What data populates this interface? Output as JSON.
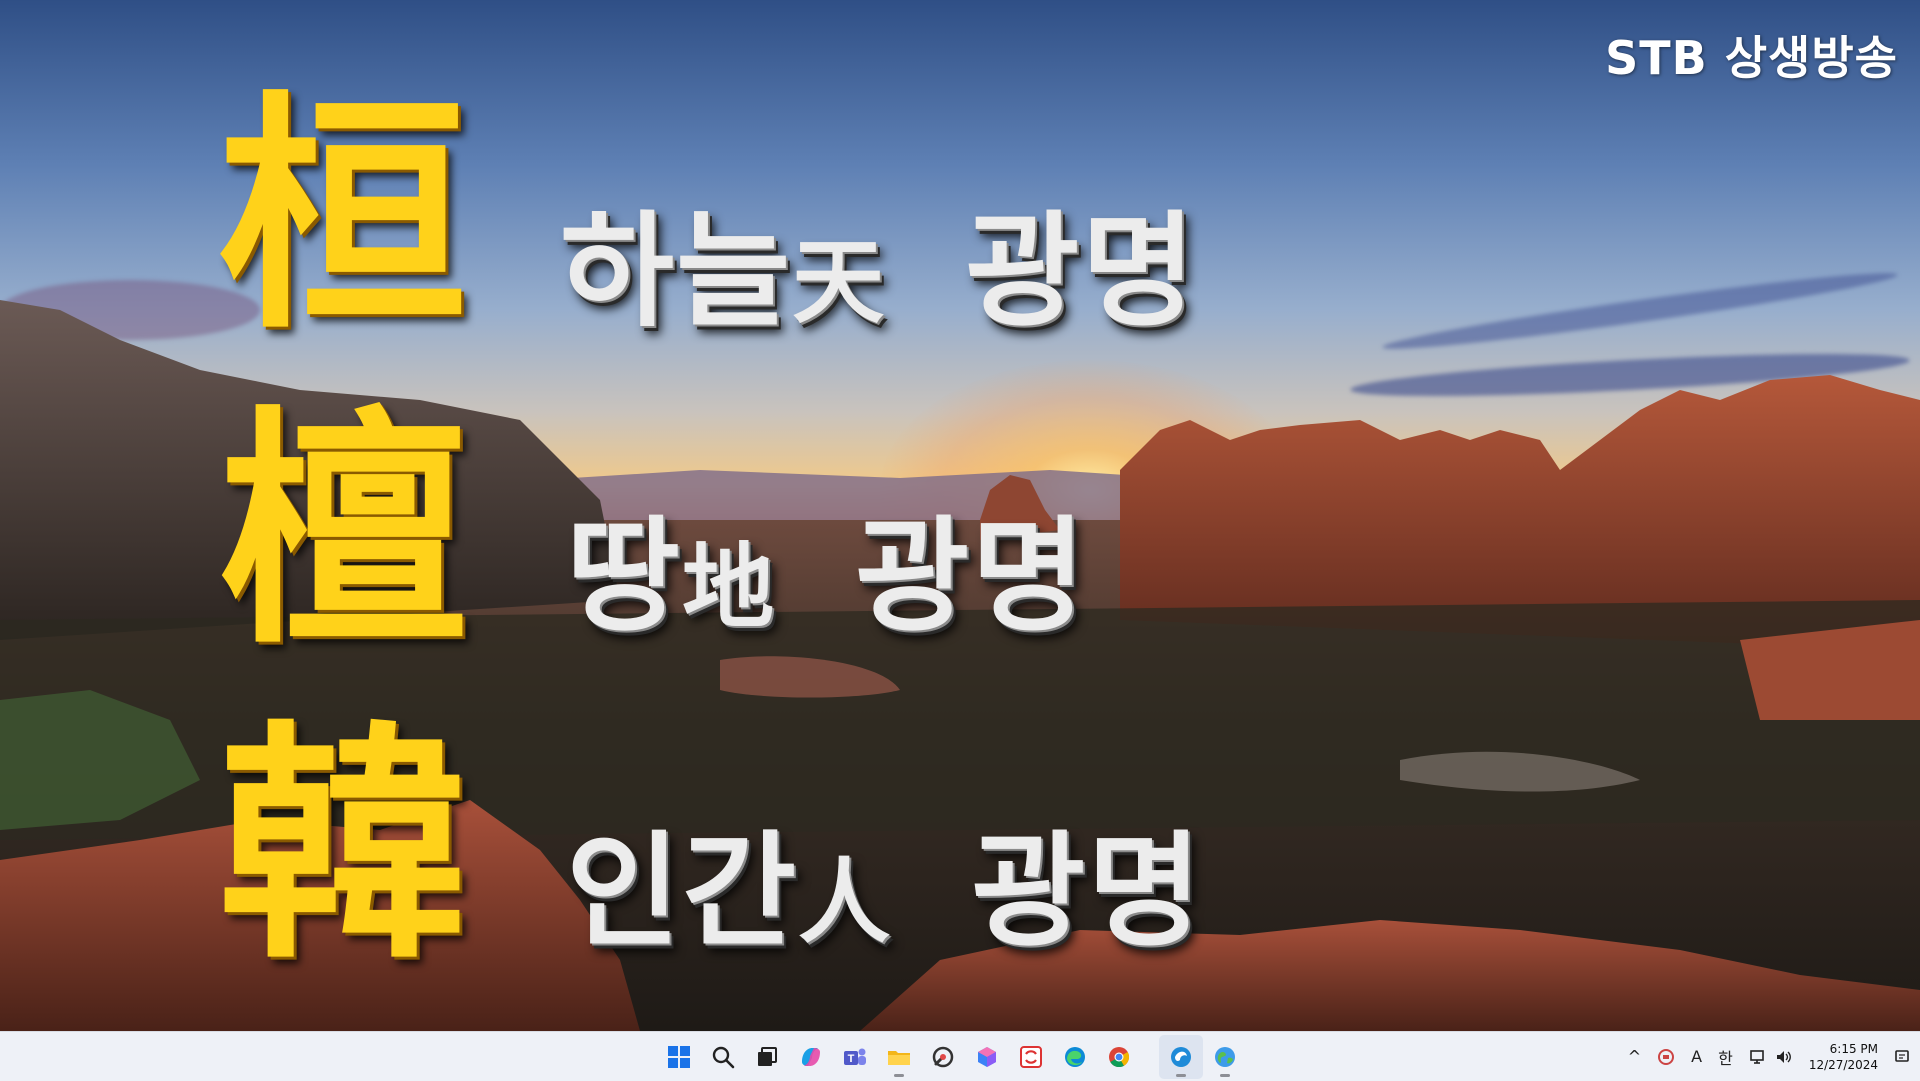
{
  "video": {
    "channel_logo": "STB 상생방송",
    "hanja": [
      "桓",
      "檀",
      "韓"
    ],
    "lines": [
      {
        "korean": "하늘",
        "hanja": "天",
        "suffix": "광명"
      },
      {
        "korean": "땅",
        "hanja": "地",
        "suffix": "광명"
      },
      {
        "korean": "인간",
        "hanja": "人",
        "suffix": "광명"
      }
    ],
    "colors": {
      "hanja": "#ffd21a",
      "phrase": "#ececec"
    }
  },
  "taskbar": {
    "center_icons": [
      "windows-start-icon",
      "search-icon",
      "task-view-icon",
      "copilot-icon",
      "teams-icon",
      "file-explorer-icon",
      "snipping-tool-icon",
      "app-icon",
      "sync-app-icon",
      "edge-icon",
      "chrome-icon",
      "active-app-icon",
      "globe-app-icon"
    ],
    "tray": {
      "chevron": "^",
      "input_mode": "A",
      "ime": "한",
      "time": "6:15 PM",
      "date": "12/27/2024"
    }
  }
}
